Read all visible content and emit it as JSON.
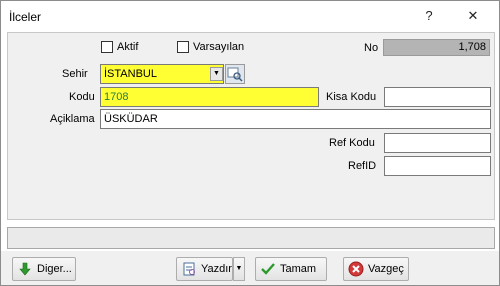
{
  "window": {
    "title": "İlceler",
    "help": "?",
    "close": "✕"
  },
  "form": {
    "aktif_label": "Aktif",
    "varsayilan_label": "Varsayılan",
    "no_label": "No",
    "no_value": "1,708",
    "sehir_label": "Sehir",
    "sehir_value": "İSTANBUL",
    "kodu_label": "Kodu",
    "kodu_value": "1708",
    "kisa_kodu_label": "Kisa Kodu",
    "kisa_kodu_value": "",
    "aciklama_label": "Açiklama",
    "aciklama_value": "ÜSKÜDAR",
    "ref_kodu_label": "Ref Kodu",
    "ref_kodu_value": "",
    "refid_label": "RefID",
    "refid_value": ""
  },
  "buttons": {
    "diger": "Diger...",
    "yazdir": "Yazdır",
    "tamam": "Tamam",
    "vazgec": "Vazgeç"
  },
  "colors": {
    "required": "#ffff33",
    "readonly": "#b4b4b4"
  }
}
